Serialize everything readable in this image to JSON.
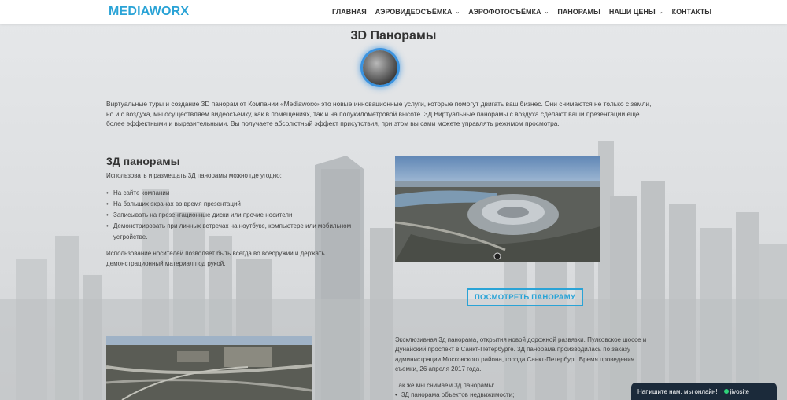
{
  "header": {
    "logo": "MEDIAWORX",
    "nav": [
      {
        "label": "ГЛАВНАЯ",
        "dropdown": false
      },
      {
        "label": "АЭРОВИДЕОСЪЁМКА",
        "dropdown": true
      },
      {
        "label": "АЭРОФОТОСЪЁМКА",
        "dropdown": true
      },
      {
        "label": "ПАНОРАМЫ",
        "dropdown": false
      },
      {
        "label": "НАШИ ЦЕНЫ",
        "dropdown": true
      },
      {
        "label": "КОНТАКТЫ",
        "dropdown": false
      }
    ]
  },
  "page": {
    "title": "3D Панорамы",
    "intro": "Виртуальные туры и создание 3D панорам от Компании «Mediaworx» это новые инновационные услуги, которые помогут двигать ваш бизнес. Они снимаются не только с земли, но и с воздуха, мы осуществляем видеосъемку, как в помещениях, так и на полукилометровой высоте. 3Д Виртуальные панорамы с воздуха сделают ваши презентации еще более эффектными и выразительными. Вы получаете абсолютный эффект присутствия, при этом вы сами можете управлять режимом просмотра."
  },
  "section": {
    "title": "3Д панорамы",
    "subtitle": "Использовать и размещать 3Д панорамы можно где угодно:",
    "bullets": [
      "На сайте компании",
      "На больших экранах во время презентаций",
      "Записывать на презентационные диски или прочие носители",
      "Демонстрировать при личных встречах на ноутбуке, компьютере или мобильном устройстве."
    ],
    "note": "Использование носителей позволяет быть всегда во всеоружии и держать демонстрационный материал под рукой."
  },
  "panorama": {
    "button_label": "ПОСМОТРЕТЬ ПАНОРАМУ"
  },
  "description": {
    "text": "Эксклюзивная 3д панорама, открытия новой дорожной развязки. Пулковское шоссе и Дунайский проспект в Санкт-Петербурге. 3Д панорама производилась по заказу администрации Московского района, города Санкт-Петербург. Время проведения съемки, 26 апреля 2017 года.",
    "subtitle": "Так же мы снимаем 3д панорамы:",
    "list": [
      "3Д панорама объектов недвижимости;"
    ]
  },
  "chat": {
    "label": "Напишите нам, мы онлайн!",
    "brand": "jivosite"
  },
  "colors": {
    "accent": "#2aa3d6",
    "chat_bg": "#1b2a3a"
  }
}
